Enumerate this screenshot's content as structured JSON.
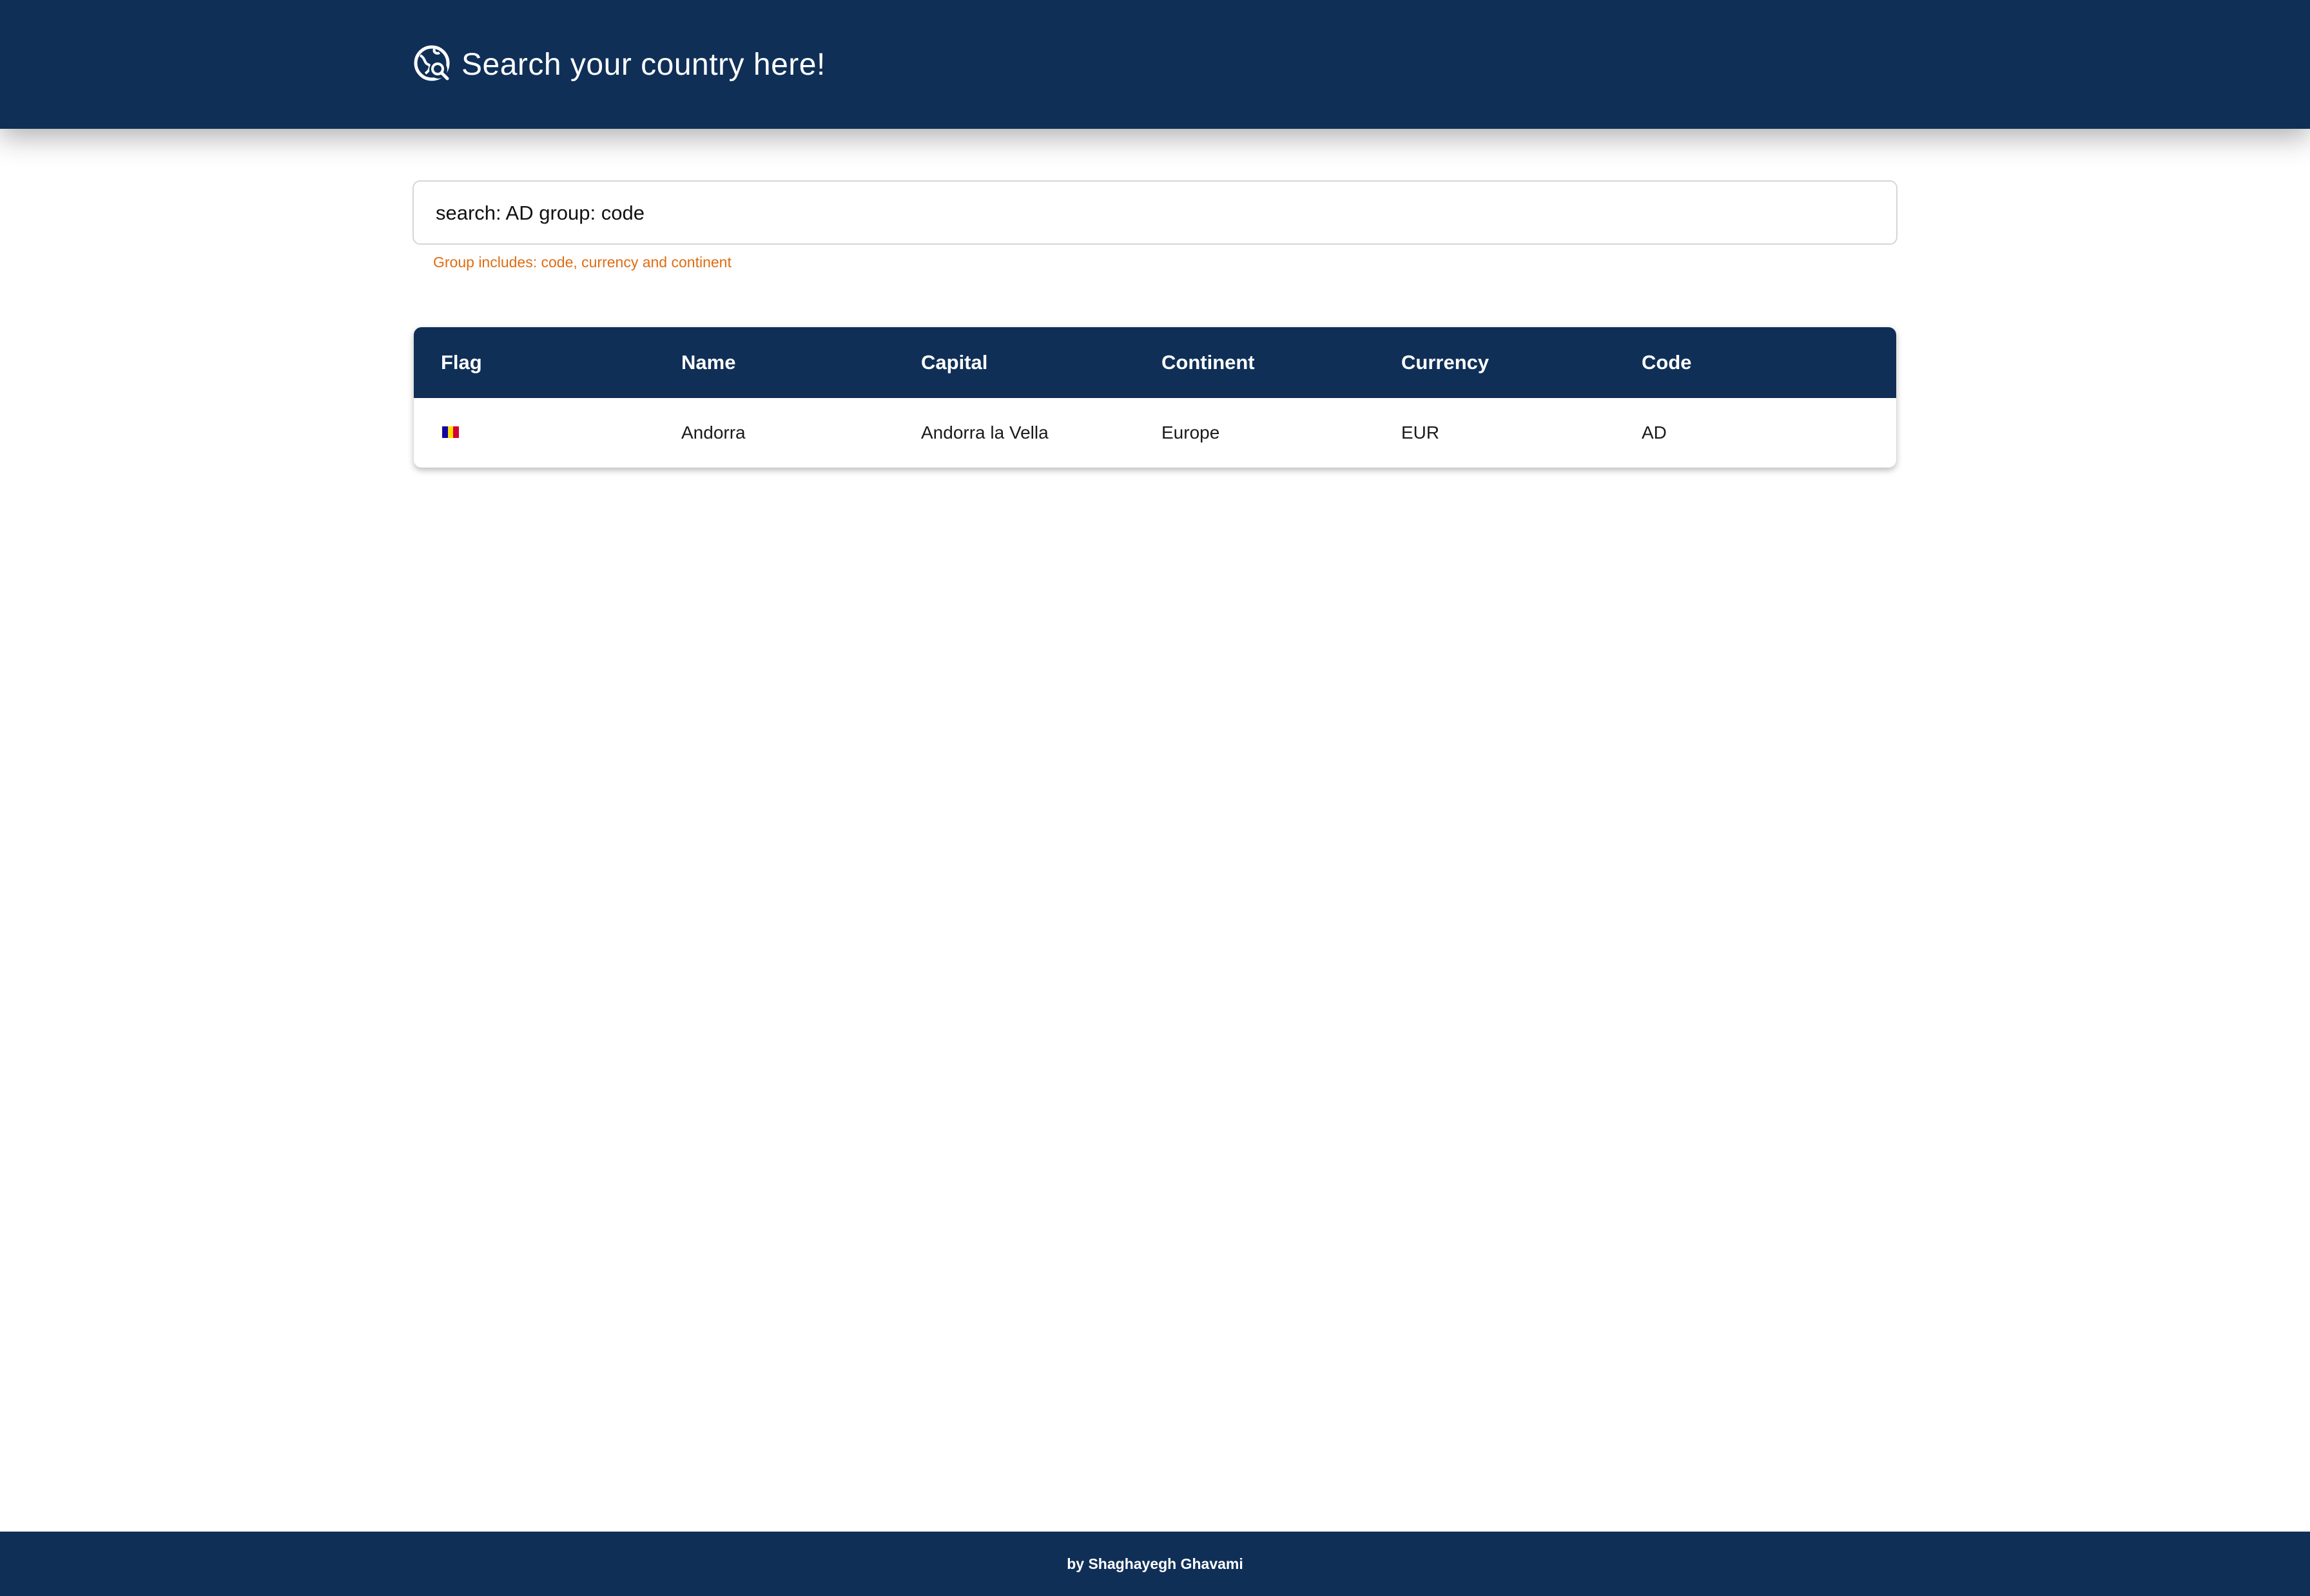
{
  "header": {
    "title": "Search your country here!",
    "icon": "globe-search-icon"
  },
  "search": {
    "value": "search: AD group: code",
    "helper": "Group includes: code, currency and continent"
  },
  "table": {
    "columns": [
      "Flag",
      "Name",
      "Capital",
      "Continent",
      "Currency",
      "Code"
    ],
    "rows": [
      {
        "flag": "andorra-flag-icon",
        "name": "Andorra",
        "capital": "Andorra la Vella",
        "continent": "Europe",
        "currency": "EUR",
        "code": "AD"
      }
    ]
  },
  "footer": {
    "credit": "by Shaghayegh Ghavami"
  },
  "colors": {
    "navy": "#0f2f57",
    "helper_orange": "#e06c12",
    "andorra_blue": "#10069f",
    "andorra_yellow": "#fedd00",
    "andorra_red": "#d50032"
  }
}
